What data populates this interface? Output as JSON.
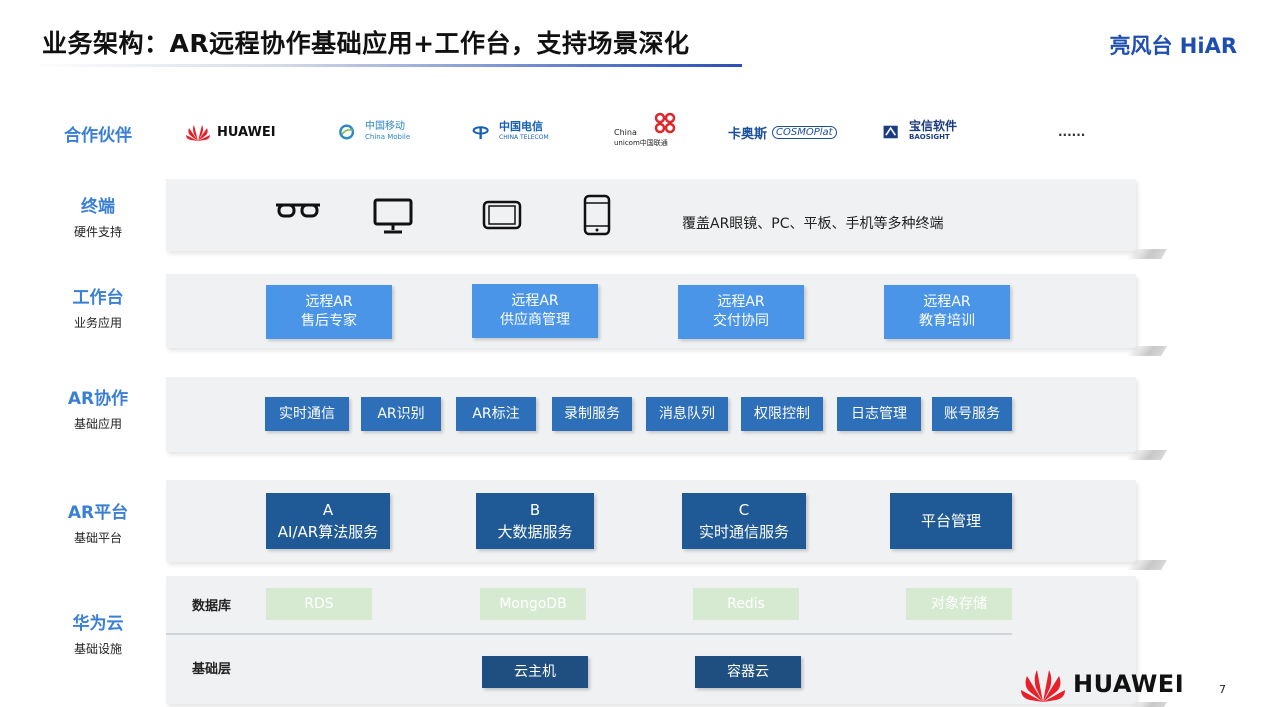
{
  "header": {
    "title": "业务架构：AR远程协作基础应用+工作台，支持场景深化",
    "brand": "亮风台 HiAR"
  },
  "rows": {
    "partners": {
      "label": "合作伙伴"
    },
    "terminal": {
      "label": "终端",
      "sublabel": "硬件支持"
    },
    "workbench": {
      "label": "工作台",
      "sublabel": "业务应用"
    },
    "ar_collab": {
      "label": "AR协作",
      "sublabel": "基础应用"
    },
    "ar_platform": {
      "label": "AR平台",
      "sublabel": "基础平台"
    },
    "huawei_cloud": {
      "label": "华为云",
      "sublabel": "基础设施"
    }
  },
  "partners": [
    {
      "name": "HUAWEI",
      "color": "#e8202a"
    },
    {
      "name": "中国移动",
      "name2": "China Mobile",
      "color": "#2a86c8"
    },
    {
      "name": "中国电信",
      "name2": "CHINA TELECOM",
      "color": "#1560b4"
    },
    {
      "name": "China",
      "name2": "unicom中国联通",
      "color": "#e0262b"
    },
    {
      "name": "卡奥斯",
      "name2": "COSMOPlat",
      "color": "#1b4f9a"
    },
    {
      "name": "宝信软件",
      "name2": "BAOSIGHT",
      "color": "#1c3c82"
    },
    {
      "name": "......",
      "color": "#333333"
    }
  ],
  "terminal": {
    "devices": [
      "glasses-icon",
      "monitor-icon",
      "tablet-icon",
      "phone-icon"
    ],
    "text": "覆盖AR眼镜、PC、平板、手机等多种终端"
  },
  "workbench": {
    "items": [
      {
        "line1": "远程AR",
        "line2": "售后专家"
      },
      {
        "line1": "远程AR",
        "line2": "供应商管理"
      },
      {
        "line1": "远程AR",
        "line2": "交付协同"
      },
      {
        "line1": "远程AR",
        "line2": "教育培训"
      }
    ]
  },
  "ar_collab": {
    "items": [
      "实时通信",
      "AR识别",
      "AR标注",
      "录制服务",
      "消息队列",
      "权限控制",
      "日志管理",
      "账号服务"
    ]
  },
  "ar_platform": {
    "items": [
      {
        "line1": "A",
        "line2": "AI/AR算法服务"
      },
      {
        "line1": "B",
        "line2": "大数据服务"
      },
      {
        "line1": "C",
        "line2": "实时通信服务"
      },
      {
        "line1": "",
        "line2": "平台管理"
      }
    ]
  },
  "cloud": {
    "db_label": "数据库",
    "db_items": [
      "RDS",
      "MongoDB",
      "Redis",
      "对象存储"
    ],
    "base_label": "基础层",
    "base_items": [
      "云主机",
      "容器云"
    ]
  },
  "footer": {
    "logo_text": "HUAWEI",
    "page_number": "7"
  },
  "colors": {
    "label_blue": "#3a7fd6",
    "workbench_box": "#4a95e8",
    "collab_box": "#2e6fba",
    "platform_box": "#1f5a96",
    "db_box": "#d6ead2",
    "base_box": "#1f4e80",
    "band_bg": "#f0f1f2"
  }
}
